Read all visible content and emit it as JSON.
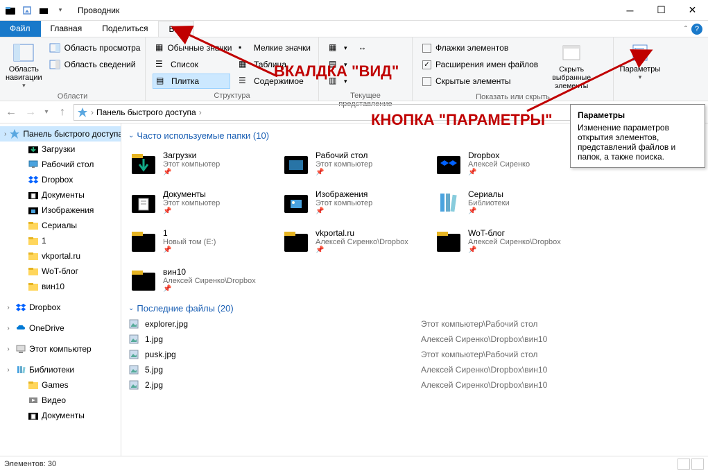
{
  "window": {
    "title": "Проводник"
  },
  "tabs": {
    "file": "Файл",
    "home": "Главная",
    "share": "Поделиться",
    "view": "Вид"
  },
  "ribbon": {
    "nav": {
      "label": "Область навигации",
      "group": "Области",
      "preview": "Область просмотра",
      "details": "Область сведений"
    },
    "layout": {
      "group": "Структура",
      "items": [
        "Обычные значки",
        "Мелкие значки",
        "Список",
        "Таблица",
        "Плитка",
        "Содержимое"
      ]
    },
    "view": {
      "group": "Текущее представление"
    },
    "show": {
      "group": "Показать или скрыть",
      "checkboxes": "Флажки элементов",
      "extensions": "Расширения имен файлов",
      "hidden": "Скрытые элементы",
      "hidebtn": "Скрыть выбранные элементы"
    },
    "options": {
      "label": "Параметры"
    }
  },
  "tooltip": {
    "header": "Параметры",
    "body": "Изменение параметров открытия элементов, представлений файлов и папок, а также поиска."
  },
  "address": {
    "path": "Панель быстрого доступа",
    "sep": "›"
  },
  "nav": [
    {
      "label": "Панель быстрого доступа",
      "icon": "star",
      "level": 0,
      "sel": true
    },
    {
      "label": "Загрузки",
      "icon": "download",
      "level": 1
    },
    {
      "label": "Рабочий стол",
      "icon": "desktop",
      "level": 1
    },
    {
      "label": "Dropbox",
      "icon": "dropbox",
      "level": 1
    },
    {
      "label": "Документы",
      "icon": "doc",
      "level": 1
    },
    {
      "label": "Изображения",
      "icon": "img",
      "level": 1
    },
    {
      "label": "Сериалы",
      "icon": "folder",
      "level": 1
    },
    {
      "label": "1",
      "icon": "folder",
      "level": 1
    },
    {
      "label": "vkportal.ru",
      "icon": "folder",
      "level": 1
    },
    {
      "label": "WoT-блог",
      "icon": "folder",
      "level": 1
    },
    {
      "label": "вин10",
      "icon": "folder",
      "level": 1
    },
    {
      "label": "",
      "icon": "",
      "level": 0,
      "spacer": true
    },
    {
      "label": "Dropbox",
      "icon": "dropbox",
      "level": 0
    },
    {
      "label": "",
      "icon": "",
      "level": 0,
      "spacer": true
    },
    {
      "label": "OneDrive",
      "icon": "onedrive",
      "level": 0
    },
    {
      "label": "",
      "icon": "",
      "level": 0,
      "spacer": true
    },
    {
      "label": "Этот компьютер",
      "icon": "pc",
      "level": 0
    },
    {
      "label": "",
      "icon": "",
      "level": 0,
      "spacer": true
    },
    {
      "label": "Библиотеки",
      "icon": "lib",
      "level": 0
    },
    {
      "label": "Games",
      "icon": "folder",
      "level": 1
    },
    {
      "label": "Видео",
      "icon": "video",
      "level": 1
    },
    {
      "label": "Документы",
      "icon": "doc",
      "level": 1
    }
  ],
  "groups": {
    "frequent": {
      "title": "Часто используемые папки (10)"
    },
    "recent": {
      "title": "Последние файлы (20)"
    }
  },
  "folders": [
    {
      "name": "Загрузки",
      "path": "Этот компьютер",
      "icon": "download"
    },
    {
      "name": "Рабочий стол",
      "path": "Этот компьютер",
      "icon": "desktop"
    },
    {
      "name": "Dropbox",
      "path": "Алексей Сиренко",
      "icon": "dropbox"
    },
    {
      "name": "Документы",
      "path": "Этот компьютер",
      "icon": "doc"
    },
    {
      "name": "Изображения",
      "path": "Этот компьютер",
      "icon": "img"
    },
    {
      "name": "Сериалы",
      "path": "Библиотеки",
      "icon": "lib"
    },
    {
      "name": "1",
      "path": "Новый том (E:)",
      "icon": "folder"
    },
    {
      "name": "vkportal.ru",
      "path": "Алексей Сиренко\\Dropbox",
      "icon": "folder"
    },
    {
      "name": "WoT-блог",
      "path": "Алексей Сиренко\\Dropbox",
      "icon": "folder"
    },
    {
      "name": "вин10",
      "path": "Алексей Сиренко\\Dropbox",
      "icon": "folder"
    }
  ],
  "files": [
    {
      "name": "explorer.jpg",
      "path": "Этот компьютер\\Рабочий стол"
    },
    {
      "name": "1.jpg",
      "path": "Алексей Сиренко\\Dropbox\\вин10"
    },
    {
      "name": "pusk.jpg",
      "path": "Этот компьютер\\Рабочий стол"
    },
    {
      "name": "5.jpg",
      "path": "Алексей Сиренко\\Dropbox\\вин10"
    },
    {
      "name": "2.jpg",
      "path": "Алексей Сиренко\\Dropbox\\вин10"
    }
  ],
  "status": {
    "count": "Элементов: 30"
  },
  "annotations": {
    "tab": "ВКАЛДКА \"ВИД\"",
    "button": "КНОПКА \"ПАРАМЕТРЫ\""
  }
}
